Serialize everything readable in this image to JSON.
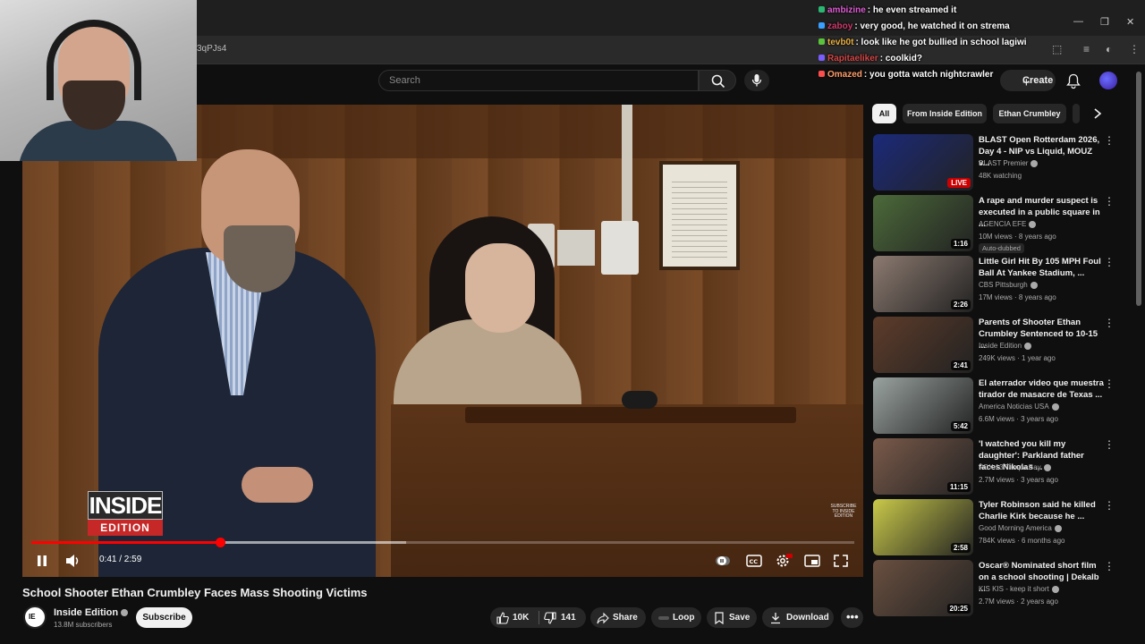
{
  "browser": {
    "url": "3qPJs4"
  },
  "chat": {
    "lines": [
      {
        "user": "ambizine",
        "message": ": he even streamed it",
        "color": "#e05dd6",
        "dot": "#2bb673"
      },
      {
        "user": "zaboy",
        "message": ": very good, he watched it on strema",
        "color": "#cf3a6e",
        "dot": "#3aa0ff"
      },
      {
        "user": "tevb0t",
        "message": ": look like he got bullied in school lagiwi",
        "color": "#e8b043",
        "dot": "#5ac43a"
      },
      {
        "user": "Rapitaeliker",
        "message": ": coolkid?",
        "color": "#d64646",
        "dot": "#7a5cff"
      },
      {
        "user": "Omazed",
        "message": ": you gotta watch nightcrawler",
        "color": "#ff9d6a",
        "dot": "#ff4d4d"
      }
    ]
  },
  "masthead": {
    "search_placeholder": "Search",
    "create_label": "Create"
  },
  "player": {
    "logo_top": "INSIDE",
    "logo_bottom": "EDITION",
    "watermark": "SUBSCRIBE TO INSIDE EDITION",
    "time": "0:41 / 2:59",
    "progress_fraction": 0.229,
    "buffered_fraction": 0.455
  },
  "video": {
    "title": "School Shooter Ethan Crumbley Faces Mass Shooting Victims",
    "channel": "Inside Edition",
    "subscribers": "13.8M subscribers",
    "subscribe_label": "Subscribe",
    "likes": "10K",
    "dislikes": "141",
    "share_label": "Share",
    "loop_label": "Loop",
    "save_label": "Save",
    "download_label": "Download"
  },
  "chips": [
    "All",
    "From Inside Edition",
    "Ethan Crumbley"
  ],
  "recommendations": [
    {
      "title": "BLAST Open Rotterdam 2026, Day 4 - NIP vs Liquid, MOUZ v...",
      "channel": "BLAST Premier",
      "meta": "48K watching",
      "badge": "LIVE",
      "thumb_color": "#1b2a7a"
    },
    {
      "title": "A rape and murder suspect is executed in a public square in ...",
      "channel": "AGENCIA EFE",
      "meta": "10M views · 8 years ago",
      "duration": "1:16",
      "extra": "Auto-dubbed",
      "thumb_color": "#4c6a3a"
    },
    {
      "title": "Little Girl Hit By 105 MPH Foul Ball At Yankee Stadium, ...",
      "channel": "CBS Pittsburgh",
      "meta": "17M views · 8 years ago",
      "duration": "2:26",
      "thumb_color": "#8c7a70"
    },
    {
      "title": "Parents of Shooter Ethan Crumbley Sentenced to 10-15 ...",
      "channel": "Inside Edition",
      "meta": "249K views · 1 year ago",
      "duration": "2:41",
      "thumb_color": "#5e3c2a"
    },
    {
      "title": "El aterrador video que muestra tirador de masacre de Texas ...",
      "channel": "America Noticias USA",
      "meta": "6.6M views · 3 years ago",
      "duration": "5:42",
      "thumb_color": "#9aa3a0"
    },
    {
      "title": "'I watched you kill my daughter': Parkland father faces Nikolas ...",
      "channel": "FOX 13 Tampa Bay",
      "meta": "2.7M views · 3 years ago",
      "duration": "11:15",
      "thumb_color": "#7a5a4a"
    },
    {
      "title": "Tyler Robinson said he killed Charlie Kirk because he ...",
      "channel": "Good Morning America",
      "meta": "784K views · 6 months ago",
      "duration": "2:58",
      "thumb_color": "#c9c94a"
    },
    {
      "title": "Oscar® Nominated short film on a school shooting | Dekalb ...",
      "channel": "KIS KIS - keep it short",
      "meta": "2.7M views · 2 years ago",
      "duration": "20:25",
      "thumb_color": "#6a5040"
    }
  ]
}
